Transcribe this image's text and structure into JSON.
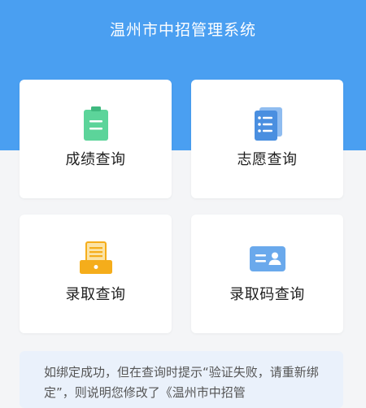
{
  "header": {
    "title": "温州市中招管理系统"
  },
  "colors": {
    "header_bg": "#4a9ff1",
    "green_icon": "#5cd49a",
    "blue_icon": "#4a8fe0",
    "orange_icon": "#f5ad1b",
    "blue_card_icon": "#6aa9ec"
  },
  "cards": [
    {
      "label": "成绩查询",
      "icon": "clipboard-icon"
    },
    {
      "label": "志愿查询",
      "icon": "document-list-icon"
    },
    {
      "label": "录取查询",
      "icon": "printer-tray-icon"
    },
    {
      "label": "录取码查询",
      "icon": "id-card-icon"
    }
  ],
  "notice": {
    "text": "如绑定成功，但在查询时提示“验证失败，请重新绑定”，则说明您修改了《温州市中招管"
  }
}
